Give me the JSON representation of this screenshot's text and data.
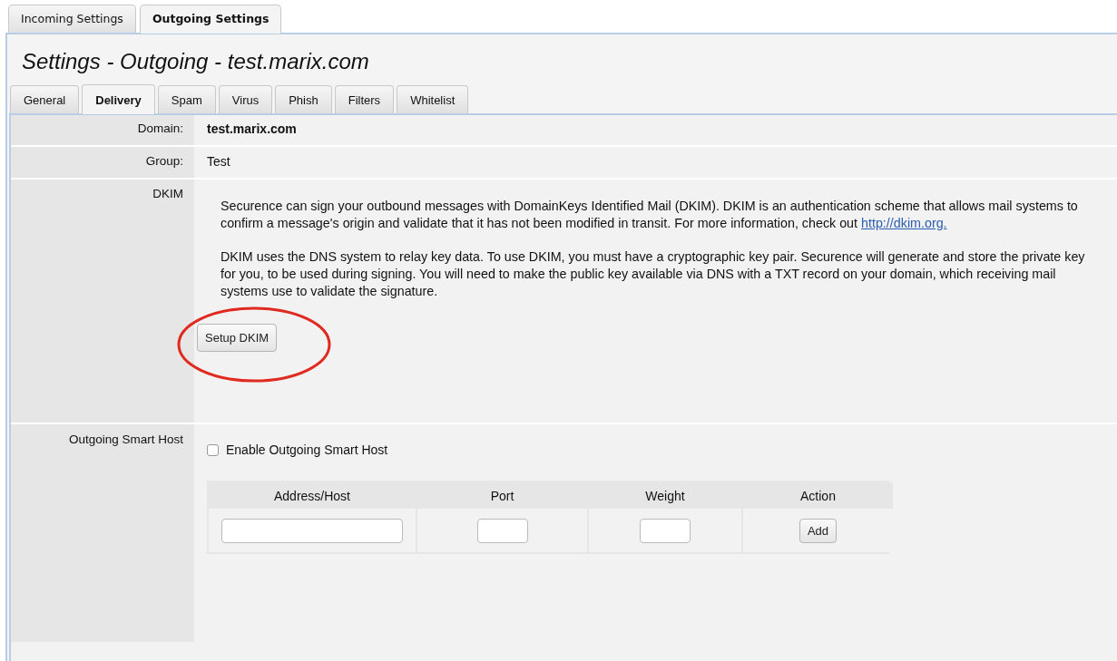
{
  "top_tabs": [
    {
      "label": "Incoming Settings",
      "selected": false
    },
    {
      "label": "Outgoing Settings",
      "selected": true
    }
  ],
  "title": "Settings - Outgoing - test.marix.com",
  "sub_tabs": [
    {
      "label": "General",
      "selected": false
    },
    {
      "label": "Delivery",
      "selected": true
    },
    {
      "label": "Spam",
      "selected": false
    },
    {
      "label": "Virus",
      "selected": false
    },
    {
      "label": "Phish",
      "selected": false
    },
    {
      "label": "Filters",
      "selected": false
    },
    {
      "label": "Whitelist",
      "selected": false
    }
  ],
  "domain": {
    "label": "Domain:",
    "value": "test.marix.com"
  },
  "group": {
    "label": "Group:",
    "value": "Test"
  },
  "dkim": {
    "label": "DKIM",
    "paragraph_1": "Securence can sign your outbound messages with DomainKeys Identified Mail (DKIM). DKIM is an authentication scheme that allows mail systems to confirm a message's origin and validate that it has not been modified in transit. For more information, check out ",
    "link": "http://dkim.org.",
    "paragraph_2": "DKIM uses the DNS system to relay key data. To use DKIM, you must have a cryptographic key pair. Securence will generate and store the private key for you, to be used during signing. You will need to make the public key available via DNS with a TXT record on your domain, which receiving mail systems use to validate the signature.",
    "button": "Setup DKIM",
    "button_highlighted": true
  },
  "smart_host": {
    "label": "Outgoing Smart Host",
    "checkbox": {
      "label": "Enable Outgoing Smart Host",
      "checked": false
    },
    "columns": [
      "Address/Host",
      "Port",
      "Weight",
      "Action"
    ],
    "add_button": "Add"
  }
}
